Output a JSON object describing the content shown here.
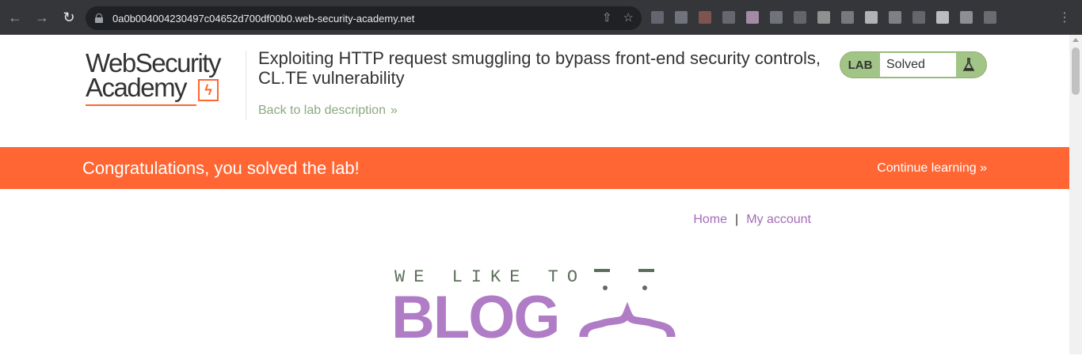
{
  "browser": {
    "url": "0a0b004004230497c04652d700df00b0.web-security-academy.net",
    "icons": [
      "back-arrow-icon",
      "forward-arrow-icon",
      "reload-icon",
      "lock-icon",
      "share-icon",
      "star-icon",
      "menu-dots-icon"
    ]
  },
  "header": {
    "logo_line1": "WebSecurity",
    "logo_line2": "Academy",
    "title": "Exploiting HTTP request smuggling to bypass front-end security controls, CL.TE vulnerability",
    "back_link": "Back to lab description",
    "back_chevron": "»",
    "lab_badge": "LAB",
    "lab_status": "Solved"
  },
  "banner": {
    "message": "Congratulations, you solved the lab!",
    "continue_label": "Continue learning",
    "continue_chevron": "»"
  },
  "nav": {
    "home": "Home",
    "separator": "|",
    "my_account": "My account"
  },
  "blog_logo": {
    "tagline": "WE LIKE TO",
    "word": "BLOG"
  },
  "colors": {
    "accent_orange": "#ff6633",
    "lab_green": "#a2c487",
    "link_purple": "#a46db8",
    "blog_purple": "#b07cc6"
  }
}
